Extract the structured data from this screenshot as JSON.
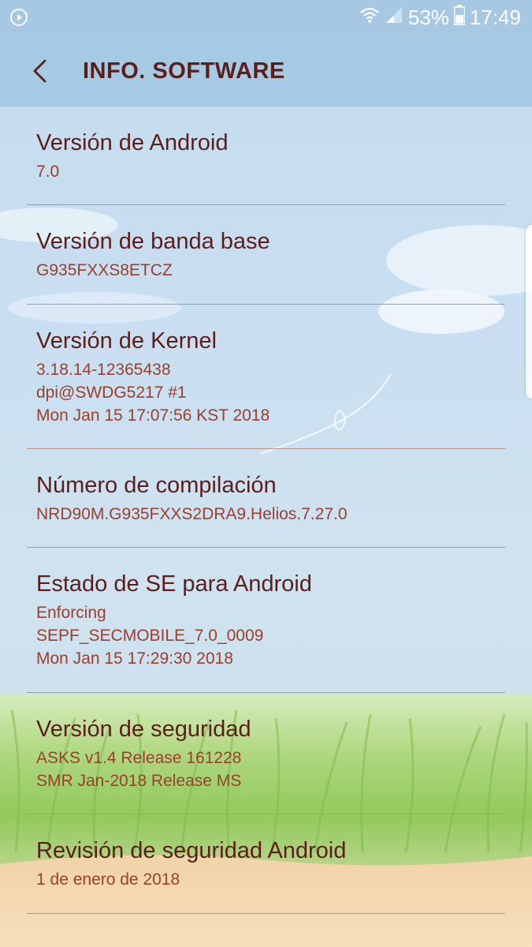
{
  "status_bar": {
    "battery_percent": "53%",
    "time": "17:49",
    "icons": [
      "media-record-icon",
      "wifi-icon",
      "signal-icon",
      "battery-icon"
    ]
  },
  "app_bar": {
    "title": "INFO. SOFTWARE",
    "back_icon": "chevron-left-icon"
  },
  "items": [
    {
      "title": "Versión de Android",
      "values": [
        "7.0"
      ]
    },
    {
      "title": "Versión de banda base",
      "values": [
        "G935FXXS8ETCZ"
      ]
    },
    {
      "title": "Versión de Kernel",
      "values": [
        "3.18.14-12365438",
        "dpi@SWDG5217 #1",
        "Mon Jan 15 17:07:56 KST 2018"
      ]
    },
    {
      "title": "Número de compilación",
      "values": [
        "NRD90M.G935FXXS2DRA9.Helios.7.27.0"
      ]
    },
    {
      "title": "Estado de SE para Android",
      "values": [
        "Enforcing",
        "SEPF_SECMOBILE_7.0_0009",
        "Mon Jan 15 17:29:30 2018"
      ]
    },
    {
      "title": "Versión de seguridad",
      "values": [
        "ASKS v1.4 Release 161228",
        "SMR Jan-2018 Release MS"
      ]
    },
    {
      "title": "Revisión de seguridad Android",
      "values": [
        "1 de enero de 2018"
      ]
    }
  ],
  "colors": {
    "title_text": "#5b1e1a",
    "value_text": "#9a3f2b",
    "divider": "#b8948a",
    "app_bar": "#a3c7e3"
  }
}
